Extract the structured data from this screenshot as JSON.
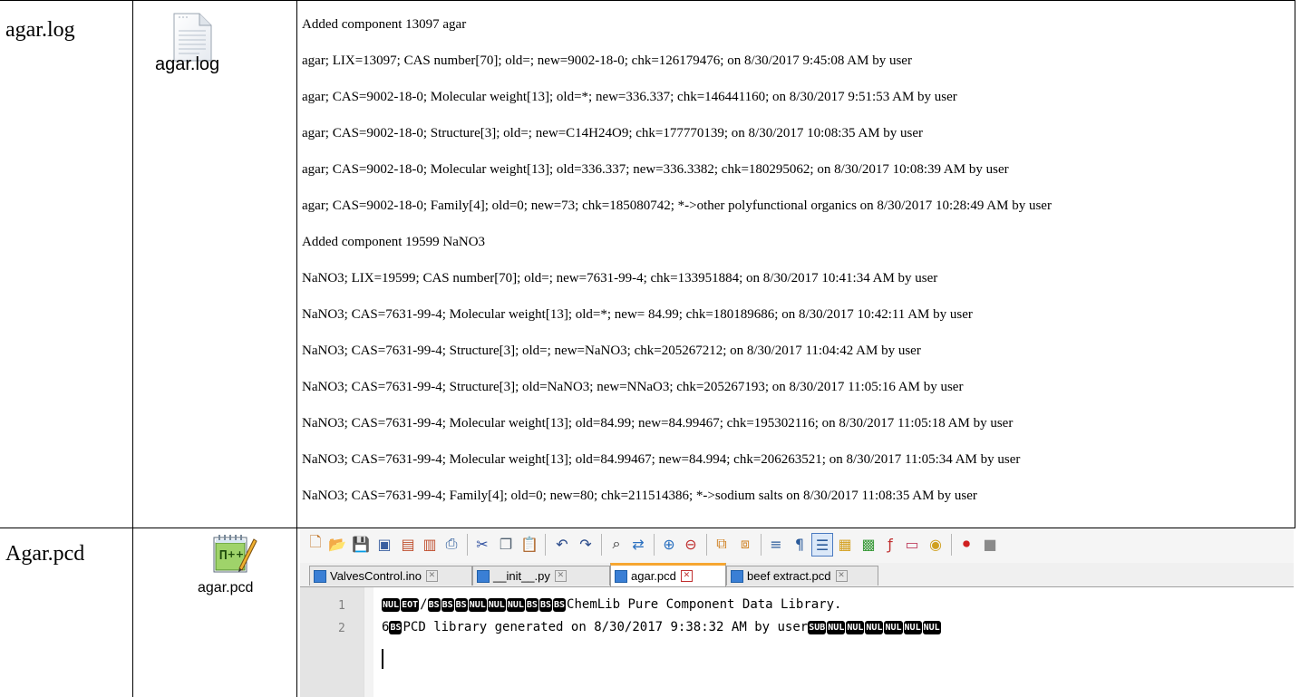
{
  "rows": [
    {
      "name": "agar.log",
      "file_label": "agar.log",
      "file_icon": "text-document-icon",
      "lines": [
        "Added component 13097 agar",
        "agar; LIX=13097; CAS number[70]; old=; new=9002-18-0; chk=126179476;  on 8/30/2017 9:45:08 AM by user",
        "agar; CAS=9002-18-0; Molecular weight[13]; old=*; new=336.337; chk=146441160;  on 8/30/2017 9:51:53 AM by user",
        "agar; CAS=9002-18-0; Structure[3]; old=; new=C14H24O9; chk=177770139;  on 8/30/2017 10:08:35 AM by user",
        "agar; CAS=9002-18-0; Molecular weight[13]; old=336.337; new=336.3382; chk=180295062;  on 8/30/2017 10:08:39 AM by user",
        "agar; CAS=9002-18-0; Family[4]; old=0; new=73; chk=185080742; *->other polyfunctional organics on 8/30/2017 10:28:49 AM by user",
        "Added component 19599 NaNO3",
        "NaNO3; LIX=19599; CAS number[70]; old=; new=7631-99-4; chk=133951884;  on 8/30/2017 10:41:34 AM by user",
        "NaNO3; CAS=7631-99-4; Molecular weight[13]; old=*; new= 84.99; chk=180189686;  on 8/30/2017 10:42:11 AM by user",
        "NaNO3; CAS=7631-99-4; Structure[3]; old=; new=NaNO3; chk=205267212;  on 8/30/2017 11:04:42 AM by user",
        "NaNO3; CAS=7631-99-4; Structure[3]; old=NaNO3; new=NNaO3; chk=205267193;  on 8/30/2017 11:05:16 AM by user",
        "NaNO3; CAS=7631-99-4; Molecular weight[13]; old=84.99; new=84.99467; chk=195302116;  on 8/30/2017 11:05:18 AM by user",
        "NaNO3; CAS=7631-99-4; Molecular weight[13]; old=84.99467; new=84.994; chk=206263521;  on 8/30/2017 11:05:34 AM by user",
        "NaNO3; CAS=7631-99-4; Family[4]; old=0; new=80; chk=211514386; *->sodium salts on 8/30/2017 11:08:35 AM by user"
      ]
    },
    {
      "name": "Agar.pcd",
      "file_label": "agar.pcd",
      "file_icon": "notepad-plus-plus-file-icon"
    }
  ],
  "editor": {
    "app": "Notepad++",
    "toolbar_icons": [
      "new-file-icon",
      "open-file-icon",
      "save-icon",
      "save-all-icon",
      "close-icon",
      "close-all-icon",
      "print-icon",
      "cut-icon",
      "copy-icon",
      "paste-icon",
      "undo-icon",
      "redo-icon",
      "find-icon",
      "replace-icon",
      "zoom-in-icon",
      "zoom-out-icon",
      "sync-vertical-icon",
      "sync-horizontal-icon",
      "word-wrap-icon",
      "show-all-characters-icon",
      "indent-guide-icon",
      "doc-map-icon",
      "function-list-icon",
      "folder-as-workspace-icon",
      "monitoring-icon",
      "record-macro-icon"
    ],
    "tabs": [
      {
        "label": "ValvesControl.ino",
        "active": false
      },
      {
        "label": "__init__.py",
        "active": false
      },
      {
        "label": "agar.pcd",
        "active": true
      },
      {
        "label": "beef extract.pcd",
        "active": false
      }
    ],
    "lines": [
      {
        "number": "1",
        "prefix_controls": [
          "NUL",
          "EOT"
        ],
        "text_a": "/",
        "mid_controls": [
          "BS",
          "BS",
          "BS",
          "NUL",
          "NUL",
          "NUL",
          "BS",
          "BS",
          "BS"
        ],
        "text_b": "ChemLib Pure Component Data Library."
      },
      {
        "number": "2",
        "text_a": "6",
        "mid_controls": [
          "BS"
        ],
        "text_b": "PCD library generated on 8/30/2017 9:38:32 AM by user",
        "suffix_controls": [
          "SUB",
          "NUL",
          "NUL",
          "NUL",
          "NUL",
          "NUL",
          "NUL"
        ]
      }
    ],
    "colors": {
      "active_tab_accent": "#f6a631",
      "file_icon": "#3a7fd5",
      "gutter": "#e4e4e4"
    }
  }
}
